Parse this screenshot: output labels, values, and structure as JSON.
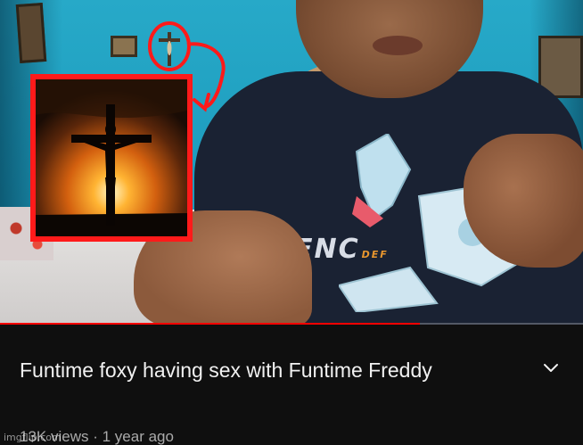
{
  "video": {
    "title": "Funtime foxy having sex with Funtime Freddy",
    "views": "13K views",
    "separator": "·",
    "age": "1 year ago",
    "progress": 0.72,
    "shirt_print": "ENC",
    "shirt_print_sub": "DEF"
  },
  "watermark": {
    "text": "imgflip.com"
  },
  "icons": {
    "expand": "chevron-down-icon",
    "inset": "crucifix-sunset-image",
    "annotation": "red-circle-arrow-icon"
  },
  "colors": {
    "background": "#0f0f0f",
    "title_text": "#f1f1f1",
    "meta_text": "#aaaaaa",
    "annotation_red": "#ff1a1a",
    "progress_red": "#ff0000"
  }
}
